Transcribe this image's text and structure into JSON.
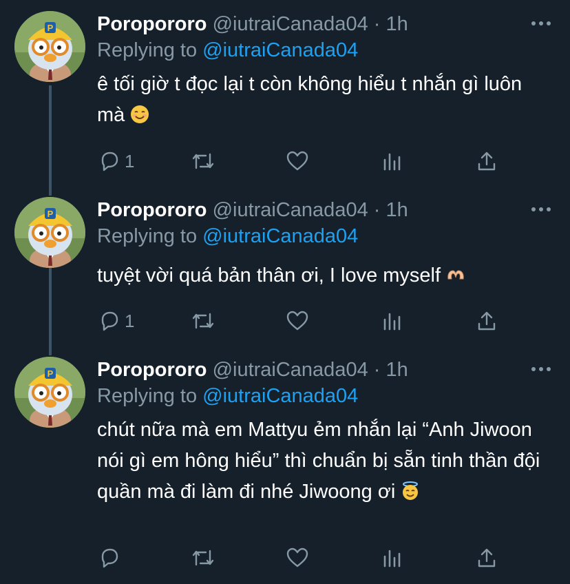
{
  "colors": {
    "background": "#15202b",
    "text": "#ffffff",
    "secondary": "#8899a6",
    "accent": "#1da1f2",
    "thread_line": "#3d5466"
  },
  "tweets": [
    {
      "name": "Poropororo",
      "handle": "@iutraiCanada04",
      "dot": "·",
      "time": "1h",
      "replying_prefix": "Replying to",
      "replying_to": "@iutraiCanada04",
      "text": "ê tối giờ t đọc lại t còn không hiểu t nhắn gì luôn mà",
      "emoji": "smiling-face-emoji",
      "reply_count": "1",
      "retweet_count": "",
      "like_count": ""
    },
    {
      "name": "Poropororo",
      "handle": "@iutraiCanada04",
      "dot": "·",
      "time": "1h",
      "replying_prefix": "Replying to",
      "replying_to": "@iutraiCanada04",
      "text": "tuyệt vời quá bản thân ơi, I love myself",
      "emoji": "heart-hands-emoji",
      "reply_count": "1",
      "retweet_count": "",
      "like_count": ""
    },
    {
      "name": "Poropororo",
      "handle": "@iutraiCanada04",
      "dot": "·",
      "time": "1h",
      "replying_prefix": "Replying to",
      "replying_to": "@iutraiCanada04",
      "text": "chút nữa mà em Mattyu ẻm nhắn lại “Anh Jiwoon nói gì em hông hiểu” thì chuẩn bị sẵn tinh thần đội quần mà đi làm đi nhé Jiwoong ơi",
      "emoji": "smiling-face-with-halo-emoji",
      "reply_count": "",
      "retweet_count": "",
      "like_count": ""
    }
  ]
}
